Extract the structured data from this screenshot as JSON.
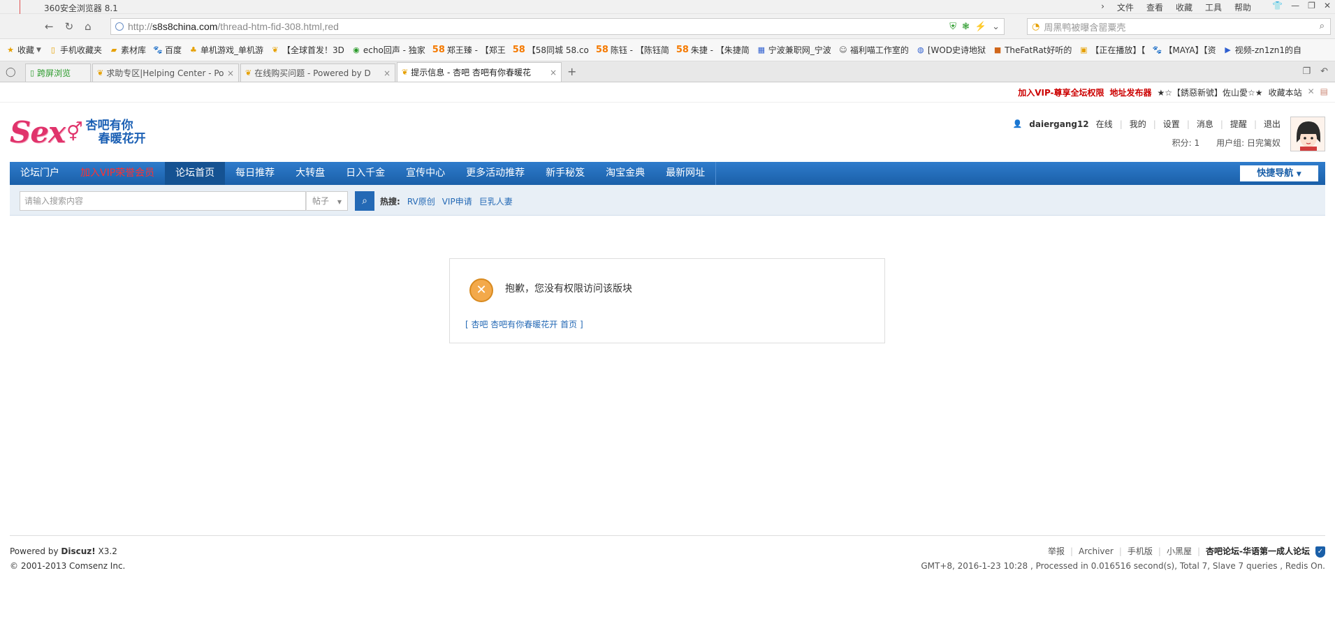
{
  "browser": {
    "title": "360安全浏览器 8.1",
    "menus": [
      "文件",
      "查看",
      "收藏",
      "工具",
      "帮助"
    ],
    "url": {
      "proto": "http://",
      "domain": "s8s8china.com",
      "path": "/thread-htm-fid-308.html,red"
    },
    "search_placeholder": "周黑鸭被曝含罂粟壳",
    "bookmarks": [
      {
        "icon": "star-icon",
        "label": "收藏"
      },
      {
        "icon": "phone-icon",
        "label": "手机收藏夹"
      },
      {
        "icon": "folder-icon",
        "label": "素材库"
      },
      {
        "icon": "baidu-icon",
        "label": "百度"
      },
      {
        "icon": "game-icon",
        "label": "单机游戏_单机游"
      },
      {
        "icon": "forum-icon",
        "label": "【全球首发！3D"
      },
      {
        "icon": "echo-icon",
        "label": "echo回声 - 独家"
      },
      {
        "icon": "58-icon",
        "label": "郑王臻 - 【郑王"
      },
      {
        "icon": "58-icon",
        "label": "【58同城 58.co"
      },
      {
        "icon": "58-icon",
        "label": "陈钰 - 【陈钰简"
      },
      {
        "icon": "58-icon",
        "label": "朱捷 - 【朱捷简"
      },
      {
        "icon": "job-icon",
        "label": "宁波兼职网_宁波"
      },
      {
        "icon": "cat-icon",
        "label": "福利喵工作室的"
      },
      {
        "icon": "wod-icon",
        "label": "[WOD史诗地狱"
      },
      {
        "icon": "fatrat-icon",
        "label": "TheFatRat好听的"
      },
      {
        "icon": "play-icon",
        "label": "【正在播放】【"
      },
      {
        "icon": "paw-icon",
        "label": "【MAYA】【资"
      },
      {
        "icon": "video-icon",
        "label": "视频-zn1zn1的自"
      }
    ],
    "tabs": [
      {
        "label": "跨屏浏览",
        "kind": "green"
      },
      {
        "label": "求助专区|Helping Center - Po",
        "kind": "t1"
      },
      {
        "label": "在线购买问题 - Powered by D",
        "kind": "t2"
      },
      {
        "label": "提示信息 - 杏吧 杏吧有你春暖花",
        "kind": "active"
      }
    ]
  },
  "topnote": {
    "vip": "加入VIP-尊享全坛权限",
    "addr": "地址发布器",
    "star": "★☆【銹惡新號】佐山愛☆★",
    "fav": "收藏本站"
  },
  "logo": {
    "sex": "Sex",
    "slogan_line1": "杏吧有你",
    "slogan_line2": "春暖花开"
  },
  "user": {
    "name": "daiergang12",
    "status": "在线",
    "links": [
      "我的",
      "设置",
      "消息",
      "提醒",
      "退出"
    ],
    "points_label": "积分: 1",
    "group_label": "用户组: 日完篱奴"
  },
  "nav": {
    "items": [
      "论坛门户",
      "加入VIP荣誉会员",
      "论坛首页",
      "每日推荐",
      "大转盘",
      "日入千金",
      "宣传中心",
      "更多活动推荐",
      "新手秘笈",
      "淘宝金典",
      "最新网址"
    ],
    "quicknav": "快捷导航"
  },
  "search": {
    "placeholder": "请输入搜索内容",
    "type": "帖子",
    "hot_label": "热搜:",
    "hot_keywords": [
      "RV原创",
      "VIP申请",
      "巨乳人妻"
    ]
  },
  "message": {
    "text": "抱歉，您没有权限访问该版块",
    "home_link": "[ 杏吧 杏吧有你春暖花开 首页 ]"
  },
  "footer": {
    "powered_prefix": "Powered by ",
    "powered_brand": "Discuz!",
    "powered_version": " X3.2",
    "copyright": "© 2001-2013 Comsenz Inc.",
    "links": [
      "举报",
      "Archiver",
      "手机版",
      "小黑屋"
    ],
    "site_name": "杏吧论坛-华语第一成人论坛",
    "stats": "GMT+8, 2016-1-23 10:28 , Processed in 0.016516 second(s), Total 7, Slave 7 queries , Redis On."
  }
}
